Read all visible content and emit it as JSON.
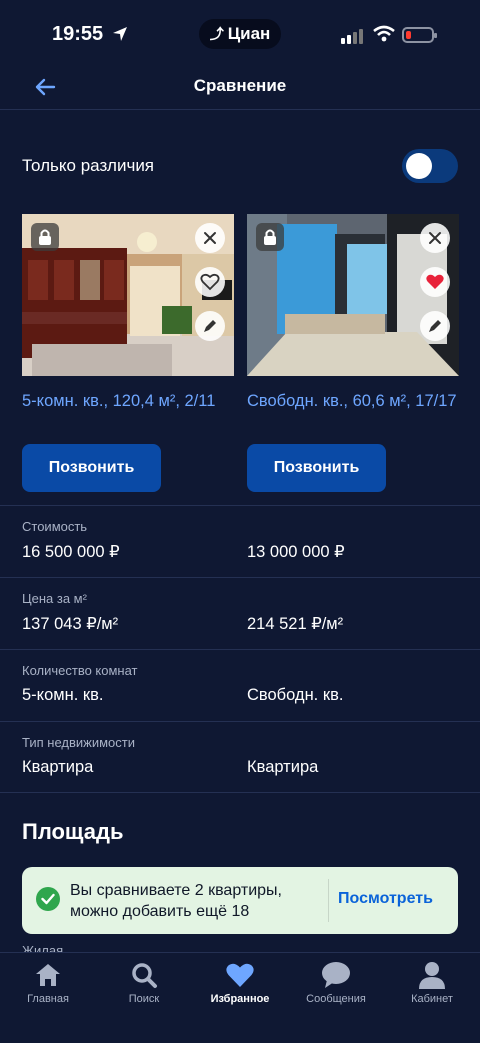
{
  "status_bar": {
    "time": "19:55",
    "app_name": "Циан"
  },
  "nav": {
    "title": "Сравнение",
    "back_icon": "arrow-left-icon"
  },
  "filter": {
    "label": "Только различия",
    "toggle_on": true
  },
  "listings": [
    {
      "title": "5-комн. кв., 120,4 м², 2/11",
      "call_label": "Позвонить",
      "favorited": false
    },
    {
      "title": "Свободн. кв., 60,6 м², 17/17",
      "call_label": "Позвонить",
      "favorited": true
    }
  ],
  "rows": [
    {
      "label": "Стоимость",
      "values": [
        "16 500 000 ₽",
        "13 000 000 ₽"
      ]
    },
    {
      "label": "Цена за м²",
      "values": [
        "137 043 ₽/м²",
        "214 521 ₽/м²"
      ]
    },
    {
      "label": "Количество комнат",
      "values": [
        "5-комн. кв.",
        "Свободн. кв."
      ]
    },
    {
      "label": "Тип недвижимости",
      "values": [
        "Квартира",
        "Квартира"
      ]
    }
  ],
  "section": {
    "title": "Площадь",
    "peek_label": "Жилая"
  },
  "toast": {
    "message": "Вы сравниваете 2 квартиры, можно добавить ещё 18",
    "action": "Посмотреть"
  },
  "tabs": [
    {
      "label": "Главная",
      "icon": "home-icon"
    },
    {
      "label": "Поиск",
      "icon": "search-icon"
    },
    {
      "label": "Избранное",
      "icon": "heart-icon",
      "active": true
    },
    {
      "label": "Сообщения",
      "icon": "chat-icon"
    },
    {
      "label": "Кабинет",
      "icon": "person-icon"
    }
  ],
  "colors": {
    "background": "#0f1833",
    "accent": "#0a4aa6",
    "link": "#6ea6ff",
    "favorite": "#e8223a",
    "toast_bg": "#e3f4e3"
  }
}
